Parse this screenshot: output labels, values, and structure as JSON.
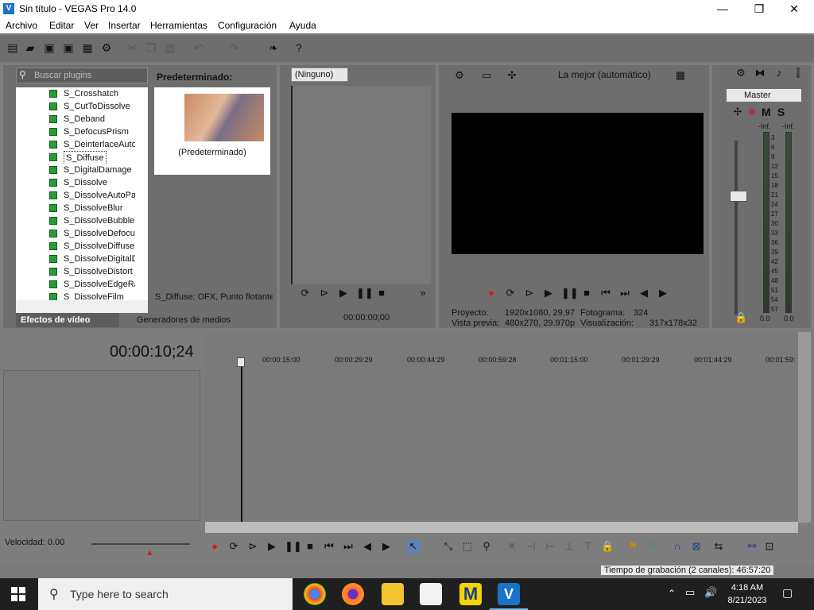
{
  "window": {
    "title": "Sin título - VEGAS Pro 14.0",
    "minimize": "—",
    "maximize": "❐",
    "close": "✕"
  },
  "menu": [
    "Archivo",
    "Editar",
    "Ver",
    "Insertar",
    "Herramientas",
    "Configuración",
    "Ayuda"
  ],
  "plugins": {
    "search_placeholder": "Buscar plugins",
    "items": [
      "S_Crosshatch",
      "S_CutToDissolve",
      "S_Deband",
      "S_DefocusPrism",
      "S_DeinterlaceAuto",
      "S_Diffuse",
      "S_DigitalDamage",
      "S_Dissolve",
      "S_DissolveAutoPai",
      "S_DissolveBlur",
      "S_DissolveBubble",
      "S_DissolveDefocus",
      "S_DissolveDiffuse",
      "S_DissolveDigitalD",
      "S_DissolveDistort",
      "S_DissolveEdgeRa",
      "S_DissolveFilm"
    ],
    "selected_index": 5,
    "preview_title": "Predeterminado:",
    "preview_caption": "(Predeterminado)",
    "status": "S_Diffuse: OFX, Punto flotante",
    "tabs": [
      "Efectos de vídeo",
      "Generadores de medios"
    ]
  },
  "trimmer": {
    "selector": "(Ninguno)",
    "timecode": "00:00:00;00"
  },
  "preview": {
    "quality": "La mejor (automático)",
    "proyecto_label": "Proyecto:",
    "proyecto_value": "1920x1080, 29.97",
    "vista_label": "Vista previa:",
    "vista_value": "480x270, 29.970p",
    "fotograma_label": "Fotograma:",
    "fotograma_value": "324",
    "visualizacion_label": "Visualización:",
    "visualizacion_value": "317x178x32"
  },
  "mixer": {
    "master": "Master",
    "m": "M",
    "s": "S",
    "inf_left": "-Inf.",
    "inf_right": "-Inf.",
    "scale": [
      "3",
      "6",
      "9",
      "12",
      "15",
      "18",
      "21",
      "24",
      "27",
      "30",
      "33",
      "36",
      "39",
      "42",
      "45",
      "48",
      "51",
      "54",
      "57"
    ],
    "bottom_left": "0.0",
    "bottom_right": "0.0"
  },
  "timeline": {
    "timecode": "00:00:10;24",
    "ruler": [
      "00:00:15:00",
      "00:00:29:29",
      "00:00:44:29",
      "00:00:59:28",
      "00:01:15:00",
      "00:01:29:29",
      "00:01:44:29",
      "00:01:59:"
    ]
  },
  "bottom": {
    "velocity": "Velocidad: 0.00",
    "recording_time": "Tiempo de grabación (2 canales): 46:57:20"
  },
  "taskbar": {
    "search": "Type here to search",
    "time": "4:18 AM",
    "date": "8/21/2023"
  },
  "colors": {
    "panel": "#6e6e6e",
    "accent": "#1a73c9",
    "taskbar": "#1f1f1f"
  }
}
